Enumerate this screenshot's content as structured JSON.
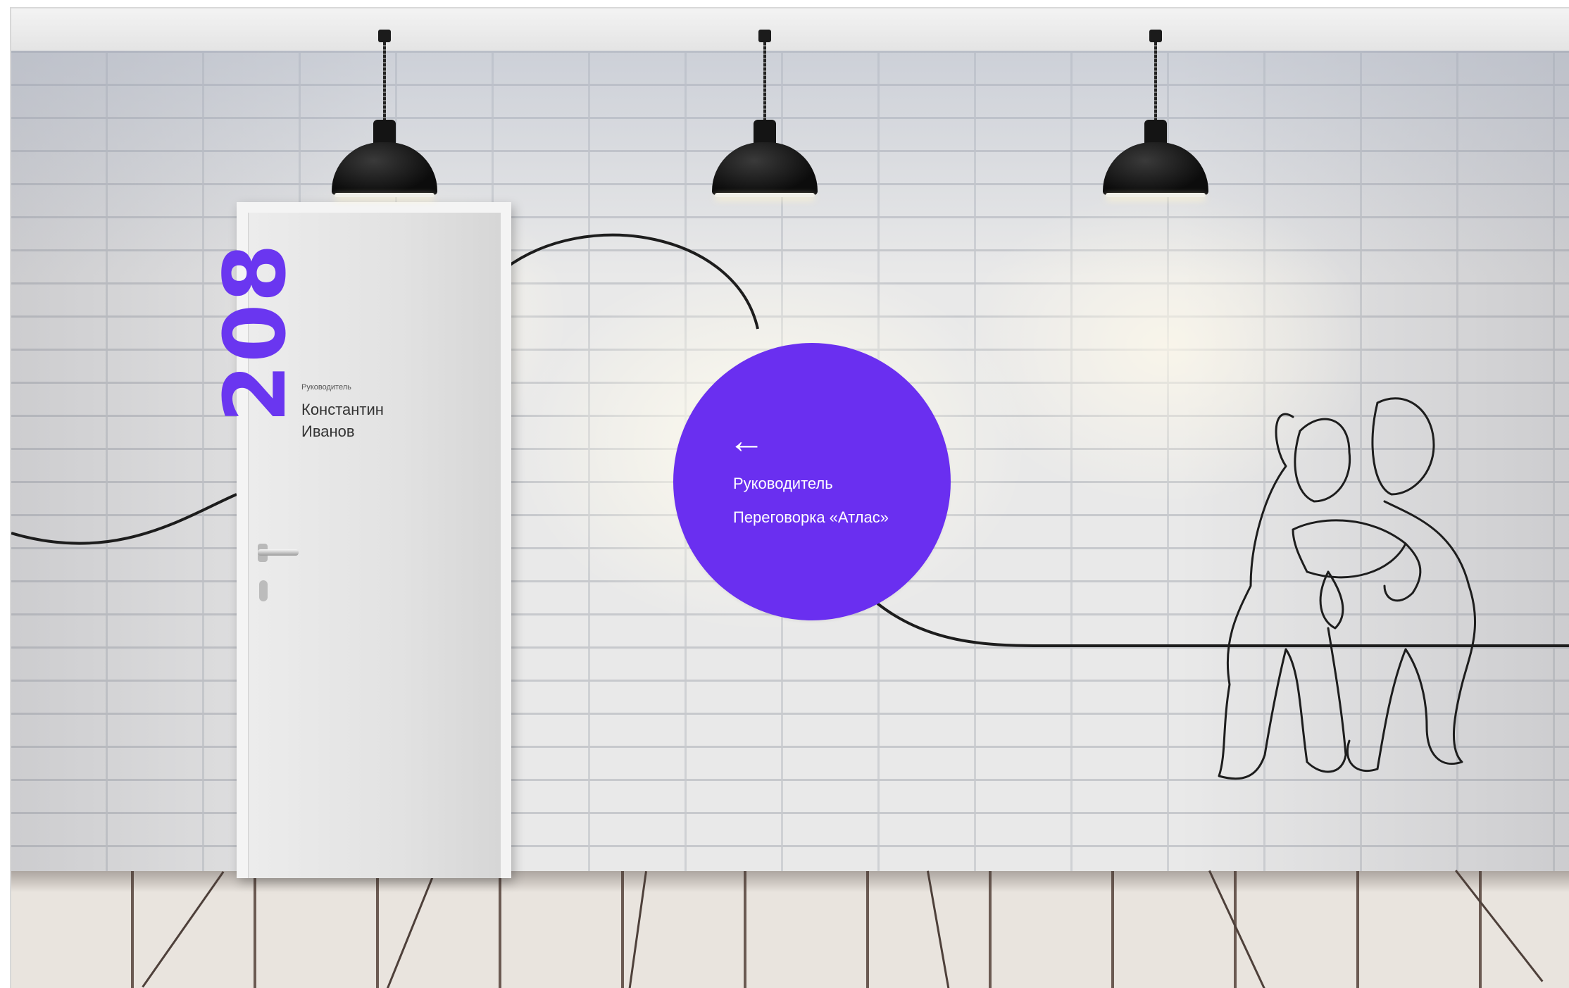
{
  "scene": {
    "accent_color": "#6a2ff0",
    "line_color": "#1d1d1d"
  },
  "door_sign": {
    "room_number": "208",
    "role": "Руководитель",
    "person_name": "Константин\nИванов"
  },
  "wayfinding_circle": {
    "arrow_icon": "arrow-left-icon",
    "items": [
      "Руководитель",
      "Переговорка «Атлас»"
    ]
  },
  "lamps": [
    "pendant-lamp-icon",
    "pendant-lamp-icon",
    "pendant-lamp-icon"
  ],
  "illustration": {
    "icon": "line-art-two-people-icon"
  }
}
